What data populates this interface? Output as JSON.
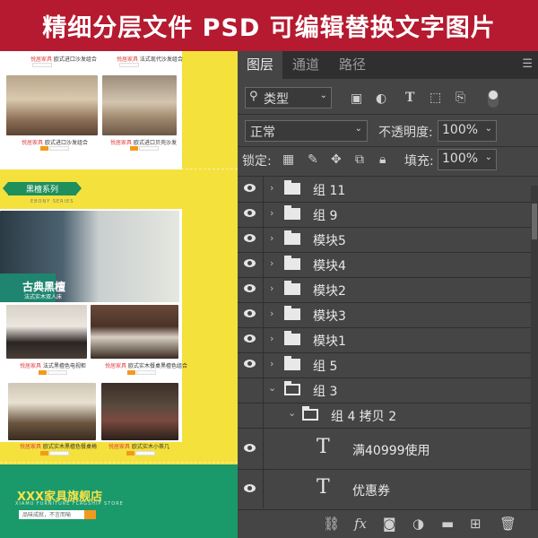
{
  "banner": {
    "text": "精细分层文件  PSD 可编辑替换文字图片"
  },
  "preview": {
    "captions_top": [
      {
        "brand": "悦居家具",
        "text": "欧式进口沙发组合"
      },
      {
        "brand": "悦居家具",
        "text": "欧式进口贝壳沙发"
      }
    ],
    "series_title": "黑檀系列",
    "series_subtitle": "EBONY SERIES",
    "hero_title": "古典黑檀",
    "hero_subtitle": "法式实木双人床",
    "captions_mid": [
      {
        "brand": "悦居家具",
        "text": "法式黑檀色电视柜"
      },
      {
        "brand": "悦居家具",
        "text": "欧式实木餐桌黑檀色组合"
      }
    ],
    "captions_bot": [
      {
        "brand": "悦居家具",
        "text": "欧式实木黑檀色餐桌椅"
      },
      {
        "brand": "悦居家具",
        "text": "欧式实木小茶几"
      }
    ],
    "store_name": "XXX家具旗舰店",
    "store_subtitle": "XIAMU FURNITURE FLAGSHIP STORE",
    "store_search": "品味成就，不言而喻"
  },
  "panel": {
    "tabs": [
      "图层",
      "通道",
      "路径"
    ],
    "filter_kind": "类型",
    "blend_mode": "正常",
    "opacity_label": "不透明度:",
    "opacity_value": "100%",
    "lock_label": "锁定:",
    "fill_label": "填充:",
    "fill_value": "100%",
    "layers": [
      {
        "name": "组 11",
        "type": "group",
        "expanded": false
      },
      {
        "name": "组 9",
        "type": "group",
        "expanded": false
      },
      {
        "name": "模块5",
        "type": "group",
        "expanded": false
      },
      {
        "name": "模块4",
        "type": "group",
        "expanded": false
      },
      {
        "name": "模块2",
        "type": "group",
        "expanded": false
      },
      {
        "name": "模块3",
        "type": "group",
        "expanded": false
      },
      {
        "name": "模块1",
        "type": "group",
        "expanded": false
      },
      {
        "name": "组 5",
        "type": "group",
        "expanded": false
      },
      {
        "name": "组 3",
        "type": "group",
        "expanded": true
      },
      {
        "name": "组 4 拷贝 2",
        "type": "group",
        "expanded": true
      },
      {
        "name": "满40999使用",
        "type": "text"
      },
      {
        "name": "优惠券",
        "type": "text"
      }
    ],
    "bottom_icons": [
      "link-icon",
      "fx-icon",
      "mask-icon",
      "adjustment-icon",
      "new-group-icon",
      "new-layer-icon",
      "trash-icon"
    ]
  }
}
